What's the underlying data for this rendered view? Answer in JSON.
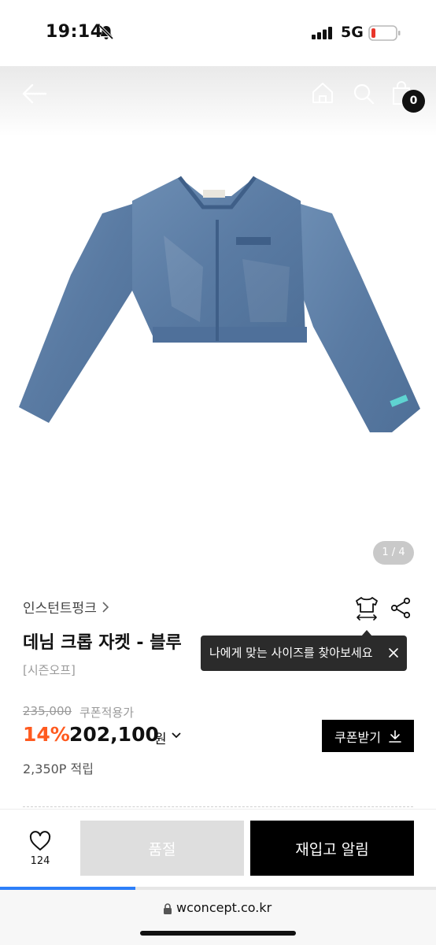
{
  "status_bar": {
    "time": "19:14",
    "network": "5G"
  },
  "gallery": {
    "cart_count": "0",
    "page_indicator": "1 / 4"
  },
  "product": {
    "brand": "인스턴트펑크",
    "title": "데님 크롭 자켓 - 블루",
    "tag": "[시즌오프]",
    "size_tooltip": "나에게 맞는 사이즈를 찾아보세요",
    "original_price": "235,000",
    "coupon_price_label": "쿠폰적용가",
    "discount_rate": "14%",
    "sale_price": "202,100",
    "currency": "원",
    "coupon_button": "쿠폰받기",
    "points": "2,350P 적립"
  },
  "actions": {
    "wish_count": "124",
    "soldout_label": "품절",
    "restock_label": "재입고 알림"
  },
  "browser": {
    "url": "wconcept.co.kr",
    "load_progress": 0.31
  },
  "colors": {
    "accent": "#ff5a1f",
    "progress": "#2d7ff9",
    "primary": "#000000"
  }
}
